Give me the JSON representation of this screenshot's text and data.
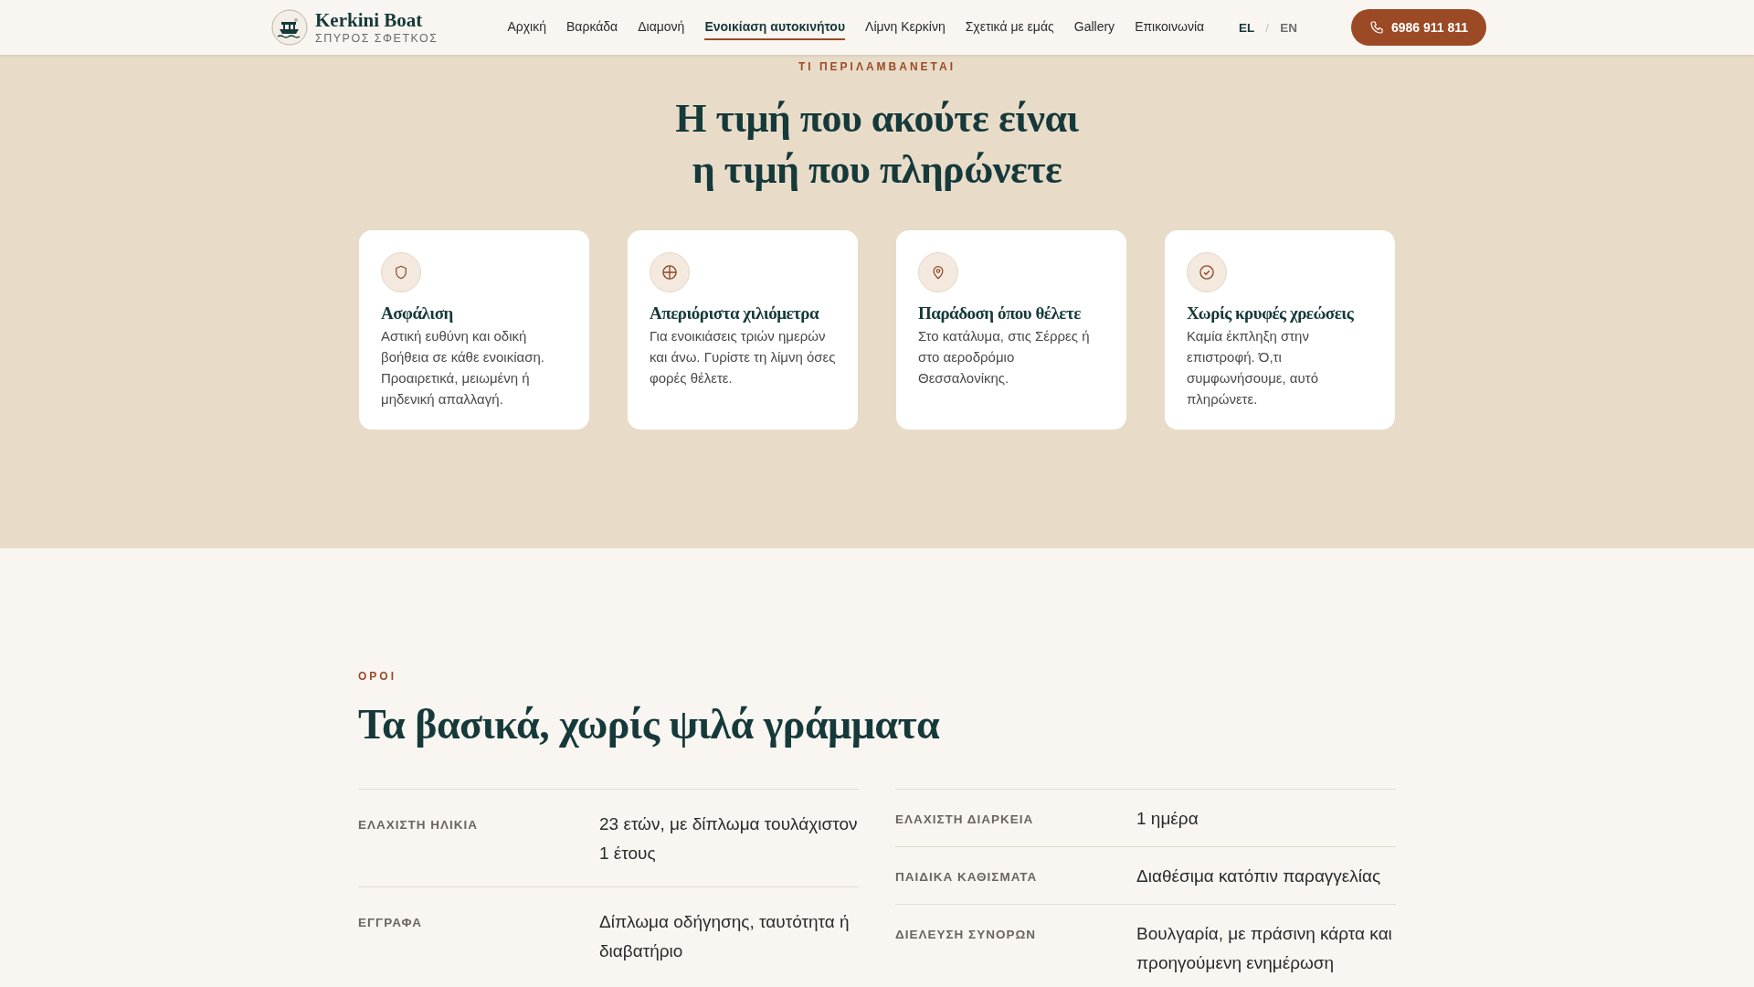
{
  "header": {
    "brand": "Kerkini Boat",
    "tagline": "ΣΠΥΡΟΣ ΣΦΕΤΚΟΣ",
    "nav": [
      {
        "label": "Αρχική",
        "selected": false
      },
      {
        "label": "Βαρκάδα",
        "selected": false
      },
      {
        "label": "Διαμονή",
        "selected": false
      },
      {
        "label": "Ενοικίαση αυτοκινήτου",
        "selected": true
      },
      {
        "label": "Λίμνη Κερκίνη",
        "selected": false
      },
      {
        "label": "Σχετικά με εμάς",
        "selected": false
      },
      {
        "label": "Gallery",
        "selected": false
      },
      {
        "label": "Επικοινωνία",
        "selected": false
      }
    ],
    "languages": [
      {
        "label": "EL",
        "selected": true
      },
      {
        "label": "EN",
        "selected": false
      }
    ],
    "language_separator": "/",
    "phone": "6986 911 811"
  },
  "included": {
    "eyebrow": "ΤΙ ΠΕΡΙΛΑΜΒΑΝΕΤΑΙ",
    "title_lines": [
      "Η τιμή που ακούτε είναι",
      "η τιμή που πληρώνετε"
    ],
    "cards": [
      {
        "kind": "shield",
        "title": "Ασφάλιση",
        "text": "Αστική ευθύνη και οδική βοήθεια σε κάθε ενοικίαση. Προαιρετικά, μειωμένη ή μηδενική απαλλαγή."
      },
      {
        "kind": "crosshair",
        "title": "Απεριόριστα χιλιόμετρα",
        "text": "Για ενοικιάσεις τριών ημερών και άνω. Γυρίστε τη λίμνη όσες φορές θέλετε."
      },
      {
        "kind": "pin",
        "title": "Παράδοση όπου θέλετε",
        "text": "Στο κατάλυμα, στις Σέρρες ή στο αεροδρόμιο Θεσσαλονίκης."
      },
      {
        "kind": "check",
        "title": "Χωρίς κρυφές χρεώσεις",
        "text": "Καμία έκπληξη στην επιστροφή. Ό,τι συμφωνήσουμε, αυτό πληρώνετε."
      }
    ]
  },
  "terms": {
    "eyebrow": "ΟΡΟΙ",
    "title": "Τα βασικά, χωρίς ψιλά γράμματα",
    "columns": [
      [
        {
          "label": "ΕΛΑΧΙΣΤΗ ΗΛΙΚΙΑ",
          "value": "23 ετών, με δίπλωμα τουλάχιστον 1 έτους"
        },
        {
          "label": "ΕΓΓΡΑΦΑ",
          "value": "Δίπλωμα οδήγησης, ταυτότητα ή διαβατήριο"
        }
      ],
      [
        {
          "label": "ΕΛΑΧΙΣΤΗ ΔΙΑΡΚΕΙΑ",
          "value": "1 ημέρα"
        },
        {
          "label": "ΠΑΙΔΙΚΑ ΚΑΘΙΣΜΑΤΑ",
          "value": "Διαθέσιμα κατόπιν παραγγελίας"
        },
        {
          "label": "ΔΙΕΛΕΥΣΗ ΣΥΝΟΡΩΝ",
          "value": "Βουλγαρία, με πράσινη κάρτα και προηγούμενη ενημέρωση"
        }
      ]
    ]
  }
}
